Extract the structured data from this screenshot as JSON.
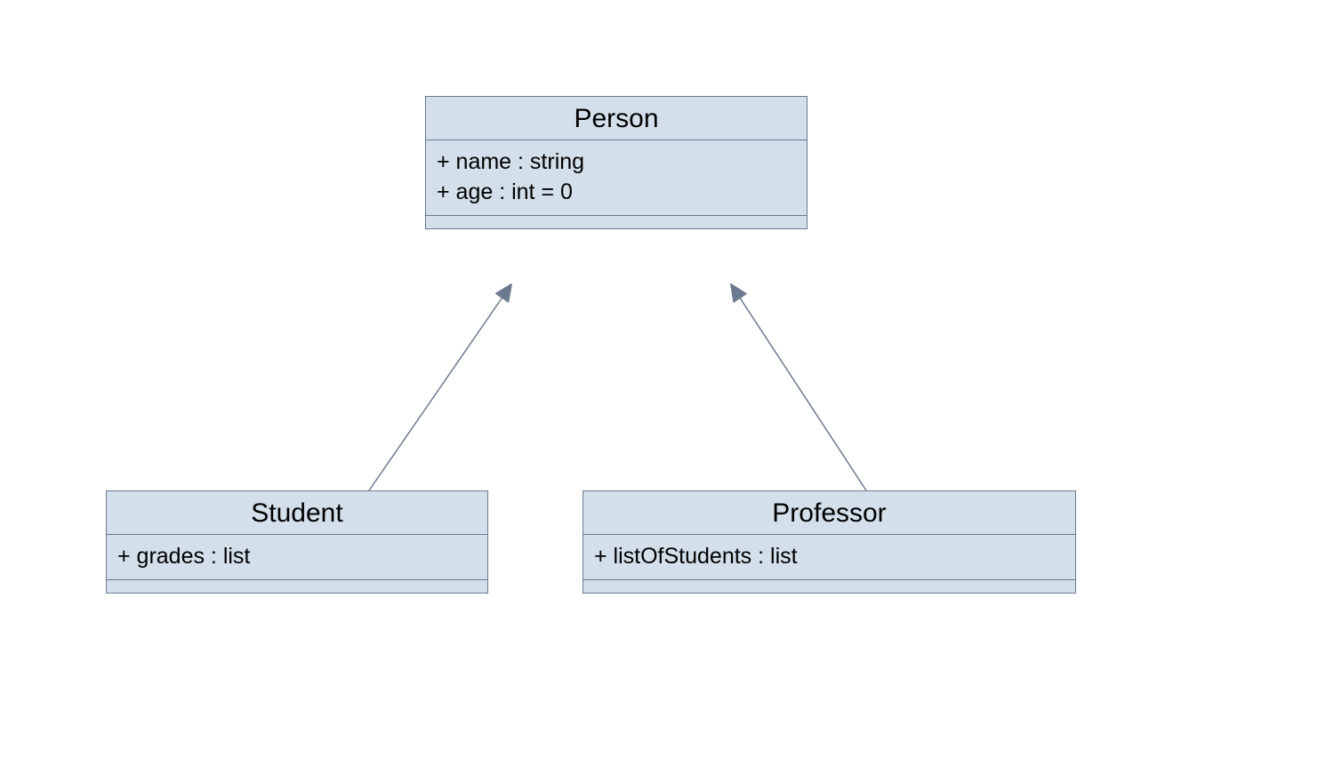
{
  "classes": {
    "person": {
      "name": "Person",
      "attributes": [
        "+ name : string",
        "+ age : int = 0"
      ],
      "operations": []
    },
    "student": {
      "name": "Student",
      "attributes": [
        "+ grades : list"
      ],
      "operations": []
    },
    "professor": {
      "name": "Professor",
      "attributes": [
        "+ listOfStudents : list"
      ],
      "operations": []
    }
  },
  "relationships": [
    {
      "type": "generalization",
      "child": "student",
      "parent": "person"
    },
    {
      "type": "generalization",
      "child": "professor",
      "parent": "person"
    }
  ],
  "colors": {
    "classFill": "#d3dfeb",
    "classBorder": "#6b7a8f",
    "arrow": "#6b7a8f"
  }
}
